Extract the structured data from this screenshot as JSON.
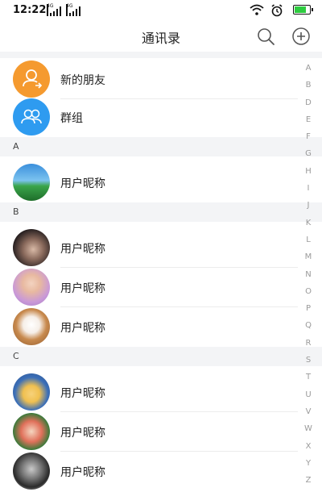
{
  "status": {
    "time": "12:22",
    "network_1": "4G",
    "network_2": "4G"
  },
  "header": {
    "title": "通讯录"
  },
  "top_items": [
    {
      "label": "新的朋友",
      "icon": "add-user-icon",
      "color": "#f59a2f"
    },
    {
      "label": "群组",
      "icon": "group-icon",
      "color": "#2e9bf0"
    }
  ],
  "sections": [
    {
      "letter": "A",
      "contacts": [
        {
          "name": "用户昵称",
          "avatar": "landscape-avatar"
        }
      ]
    },
    {
      "letter": "B",
      "contacts": [
        {
          "name": "用户昵称",
          "avatar": "girl-avatar"
        },
        {
          "name": "用户昵称",
          "avatar": "child-avatar"
        },
        {
          "name": "用户昵称",
          "avatar": "dog-avatar"
        }
      ]
    },
    {
      "letter": "C",
      "contacts": [
        {
          "name": "用户昵称",
          "avatar": "cartoon-avatar"
        },
        {
          "name": "用户昵称",
          "avatar": "anime-avatar"
        },
        {
          "name": "用户昵称",
          "avatar": "portrait-avatar"
        }
      ]
    }
  ],
  "index_letters": [
    "A",
    "B",
    "D",
    "E",
    "F",
    "G",
    "H",
    "I",
    "J",
    "K",
    "L",
    "M",
    "N",
    "O",
    "P",
    "Q",
    "R",
    "S",
    "T",
    "U",
    "V",
    "W",
    "X",
    "Y",
    "Z"
  ]
}
